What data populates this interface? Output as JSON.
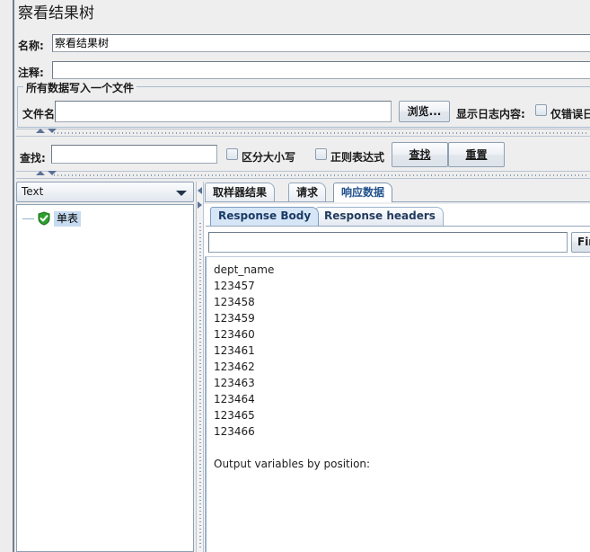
{
  "panel": {
    "title": "察看结果树"
  },
  "fields": {
    "name_label": "名称:",
    "name_value": "察看结果树",
    "comment_label": "注释:",
    "comment_value": ""
  },
  "file_group": {
    "title": "所有数据写入一个文件",
    "filename_label": "文件名",
    "filename_value": "",
    "browse_button": "浏览...",
    "log_display_label": "显示日志内容:",
    "errors_only_label": "仅错误日",
    "errors_only_checked": false
  },
  "search_bar": {
    "search_label": "查找:",
    "search_value": "",
    "case_sensitive_label": "区分大小写",
    "case_sensitive_checked": false,
    "regex_label": "正则表达式",
    "regex_checked": false,
    "find_button": "查找",
    "reset_button": "重置"
  },
  "tree_panel": {
    "renderer_selected": "Text",
    "node_label": "单表",
    "node_status_icon": "green-check-shield-icon"
  },
  "main_tabs": [
    {
      "label": "取样器结果",
      "selected": false
    },
    {
      "label": "请求",
      "selected": false
    },
    {
      "label": "响应数据",
      "selected": true
    }
  ],
  "sub_tabs": [
    {
      "label": "Response Body",
      "selected": true
    },
    {
      "label": "Response headers",
      "selected": false
    }
  ],
  "response": {
    "find_input_value": "",
    "find_button": "Find",
    "body_lines": [
      "dept_name",
      "123457",
      "123458",
      "123459",
      "123460",
      "123461",
      "123462",
      "123463",
      "123464",
      "123465",
      "123466",
      "",
      "Output variables by position:"
    ]
  },
  "colors": {
    "background": "#eeeeee",
    "panel_white": "#ffffff",
    "border_blue": "#8ea0b4",
    "tab_selected_text": "#20518c",
    "subtab_selected_bg": "#d7e6f6",
    "splitter_arrow": "#5b7196",
    "status_green": "#30a030",
    "selection_blue": "#c7dbf0"
  }
}
